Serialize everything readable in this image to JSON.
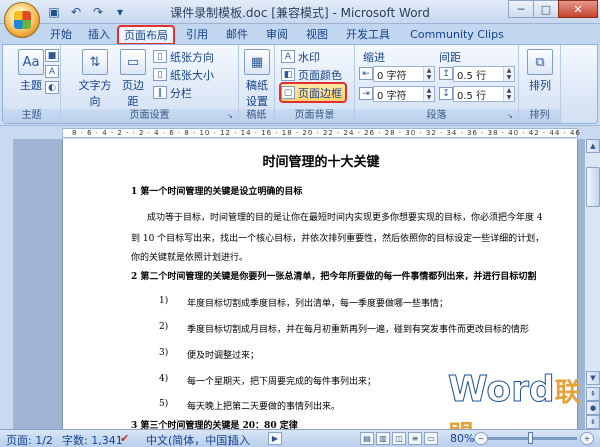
{
  "window": {
    "title": "课件录制模板.doc [兼容模式] - Microsoft Word",
    "controls": [
      "─",
      "□",
      "✕"
    ]
  },
  "quick_access": [
    "save-icon",
    "undo-icon",
    "redo-icon",
    "customize-icon"
  ],
  "tabs": [
    {
      "label": "开始"
    },
    {
      "label": "插入"
    },
    {
      "label": "页面布局",
      "active": true
    },
    {
      "label": "引用"
    },
    {
      "label": "邮件"
    },
    {
      "label": "审阅"
    },
    {
      "label": "视图"
    },
    {
      "label": "开发工具"
    },
    {
      "label": "Community Clips"
    }
  ],
  "ribbon": {
    "themes": {
      "label": "主题",
      "group": "主题",
      "aa": "Aa"
    },
    "page_setup": {
      "group": "页面设置",
      "text_direction": "文字方向",
      "margins": "页边距",
      "orientation": "纸张方向",
      "size": "纸张大小",
      "columns": "分栏"
    },
    "draft": {
      "group": "稿纸",
      "label_line1": "稿纸",
      "label_line2": "设置"
    },
    "page_background": {
      "group": "页面背景",
      "watermark": "水印",
      "page_color": "页面颜色",
      "page_borders": "页面边框"
    },
    "paragraph": {
      "group": "段落",
      "indent": "缩进",
      "spacing": "间距",
      "indent_left": "0 字符",
      "indent_right": "0 字符",
      "spacing_before": "0.5 行",
      "spacing_after": "0.5 行"
    },
    "arrange": {
      "group": "排列",
      "label": "排列"
    }
  },
  "ruler_marks": "8 · 6 · 4 · 2 ·  · 2 · 4 · 6 · 8 · 10 · 12 · 14 · 16 · 18 · 20 · 22 · 24 · 26 · 28 · 30 · 32 · 34 · 36 · 38 · 40 · 42 · 44 · 46",
  "document": {
    "title": "时间管理的十大关键",
    "h1": "1    第一个时间管理的关键是设立明确的目标",
    "p1_l1": "成功等于目标，时间管理的目的是让你在最短时间内实现更多你想要实现的目标，你必须把今年度 4",
    "p1_l2": "到 10 个目标写出来，找出一个核心目标，并依次排列重要性，然后依照你的目标设定一些详细的计划，",
    "p1_l3": "你的关键就是依照计划进行。",
    "h2": "2    第二个时间管理的关键是你要列一张总清单，把今年所要做的每一件事情都列出来，并进行目标切割",
    "items": [
      {
        "num": "1)",
        "text": "年度目标切割成季度目标，列出清单，每一季度要做哪一些事情；"
      },
      {
        "num": "2)",
        "text": "季度目标切割成月目标，并在每月初重新再列一遍，碰到有突发事件而更改目标的情形"
      },
      {
        "num": "3)",
        "text": "便及时调整过来；"
      },
      {
        "num": "4)",
        "text": "每一个星期天，把下周要完成的每件事列出来；"
      },
      {
        "num": "5)",
        "text": "每天晚上把第二天要做的事情列出来。"
      }
    ],
    "h3": "3    第三个时间管理的关键是 20：80 定律"
  },
  "watermark": {
    "url": "www.wordlm.com",
    "logo_word": "Word",
    "logo_cn": "联盟"
  },
  "status": {
    "page": "页面: 1/2",
    "words": "字数: 1,341",
    "language": "中文(简体，中国)",
    "mode": "插入",
    "zoom": "80%"
  }
}
